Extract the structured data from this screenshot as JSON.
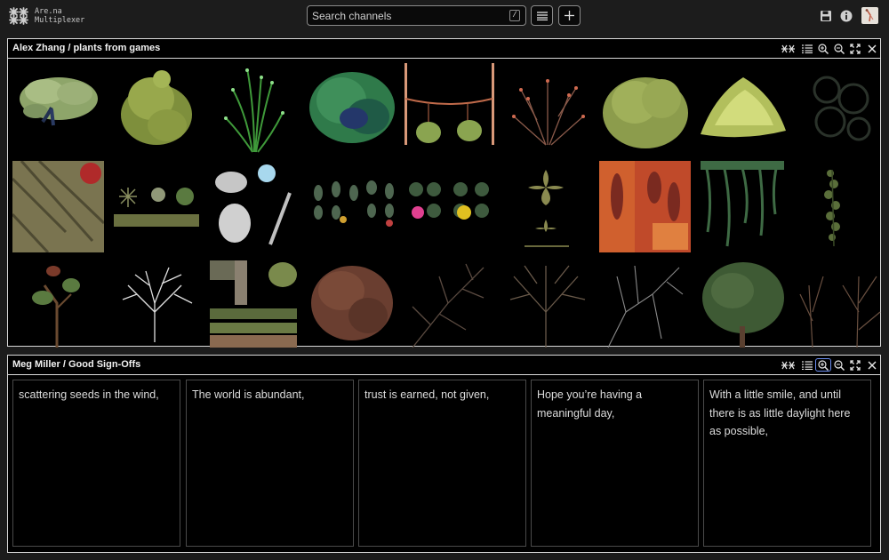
{
  "app": {
    "name_line1": "Are.na",
    "name_line2": "Multiplexer"
  },
  "search": {
    "placeholder": "Search channels",
    "shortcut": "/"
  },
  "toolbar": {
    "list_icon": "list-icon",
    "add_icon": "plus-icon"
  },
  "header_right": {
    "save_icon": "save-icon",
    "info_icon": "info-icon",
    "avatar_icon": "avatar"
  },
  "panels": [
    {
      "title": "Alex Zhang / plants from games",
      "controls": [
        "asterisk-icon",
        "list-icon",
        "zoom-in-icon",
        "zoom-out-icon",
        "fullscreen-icon",
        "close-icon"
      ],
      "tiles": [
        "tree",
        "shrub",
        "grass",
        "dense-bush",
        "hanging-pots",
        "berry-bush",
        "leafy-bush",
        "yellow-mound",
        "dark-leaves",
        "bark-texture",
        "plant-sprites",
        "white-leaves",
        "leaf-sprites",
        "lilypad-sprites",
        "cross-leaves",
        "red-leaves",
        "hanging-vines",
        "ivy",
        "small-tree",
        "white-tree",
        "hedge-sprites",
        "brown-bush",
        "bare-branches",
        "bare-tree",
        "thin-branches",
        "pine-tree",
        "twig-bushes"
      ]
    },
    {
      "title": "Meg Miller / Good Sign-Offs",
      "controls": [
        "asterisk-icon",
        "list-icon",
        "zoom-in-icon",
        "zoom-out-icon",
        "fullscreen-icon",
        "close-icon"
      ],
      "active_control": "zoom-in-icon",
      "cards": [
        "scattering seeds in the wind,",
        "The world is abundant,",
        "trust is earned, not given,",
        "Hope you’re having a meaningful day,",
        "With a little smile, and until there is as little daylight here as possible,"
      ]
    }
  ]
}
